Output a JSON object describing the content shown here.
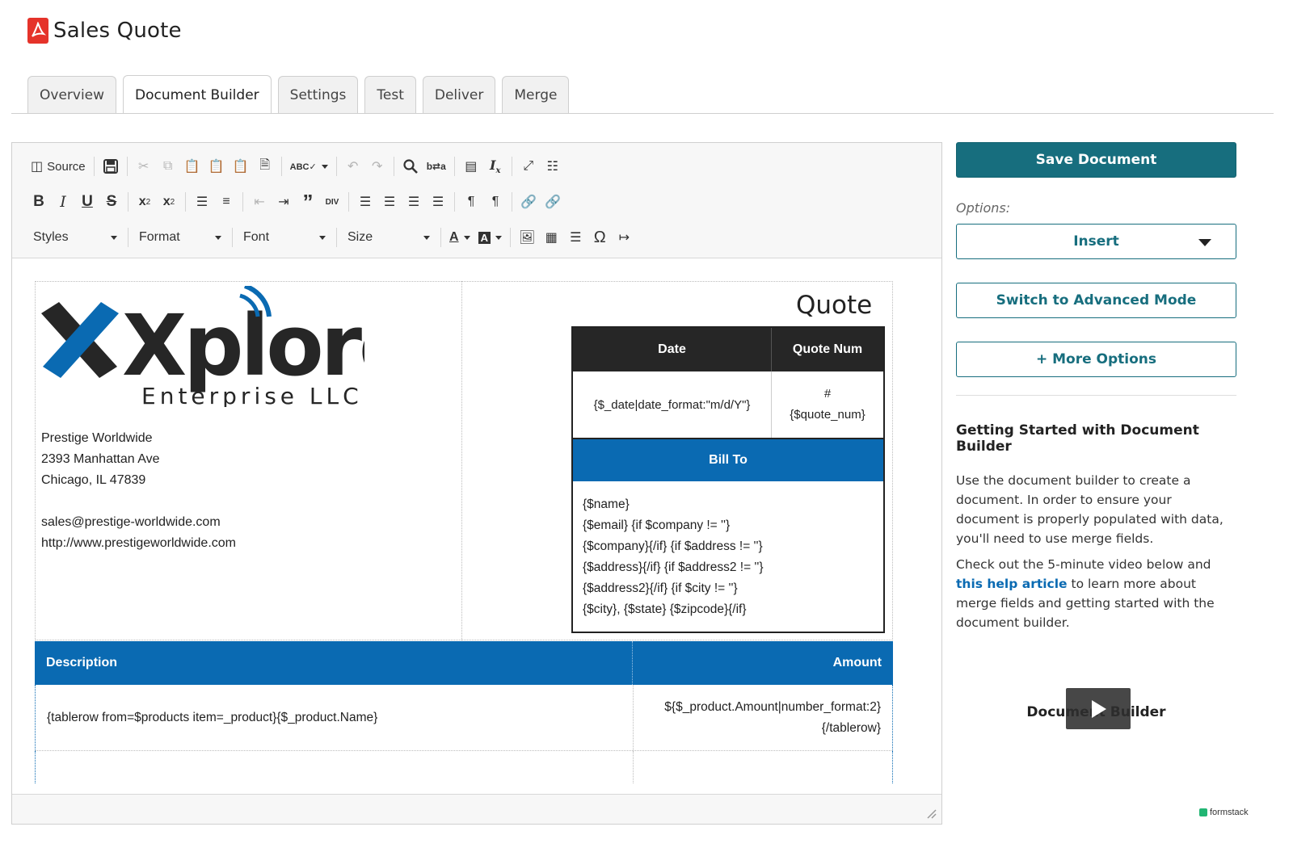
{
  "app": {
    "title": "Sales Quote",
    "icon": "pdf-icon"
  },
  "tabs": [
    {
      "label": "Overview",
      "active": false
    },
    {
      "label": "Document Builder",
      "active": true
    },
    {
      "label": "Settings",
      "active": false
    },
    {
      "label": "Test",
      "active": false
    },
    {
      "label": "Deliver",
      "active": false
    },
    {
      "label": "Merge",
      "active": false
    }
  ],
  "toolbar": {
    "source_label": "Source",
    "styles_label": "Styles",
    "format_label": "Format",
    "font_label": "Font",
    "size_label": "Size"
  },
  "document": {
    "logo": {
      "brand": "Xplore",
      "subtitle": "Enterprise LLC"
    },
    "company": {
      "name": "Prestige Worldwide",
      "street": "2393 Manhattan Ave",
      "city": "Chicago, IL 47839",
      "email": "sales@prestige-worldwide.com",
      "website": "http://www.prestigeworldwide.com"
    },
    "quote_title": "Quote",
    "meta": {
      "date_header": "Date",
      "quote_num_header": "Quote Num",
      "date_value": "{$_date|date_format:\"m/d/Y\"}",
      "quote_num_prefix": "#",
      "quote_num_value": "{$quote_num}"
    },
    "bill_to": {
      "header": "Bill To",
      "lines": [
        "{$name}",
        "{$email} {if $company != ''}",
        "{$company}{/if} {if $address != ''}",
        "{$address}{/if} {if $address2 != ''}",
        "{$address2}{/if} {if $city != ''}",
        "{$city}, {$state} {$zipcode}{/if}"
      ]
    },
    "line_items": {
      "description_header": "Description",
      "amount_header": "Amount",
      "row_description": "{tablerow from=$products item=_product}{$_product.Name}",
      "row_amount_line1": "${$_product.Amount|number_format:2}",
      "row_amount_line2": "{/tablerow}"
    }
  },
  "side_panel": {
    "save_label": "Save Document",
    "options_label": "Options:",
    "insert_label": "Insert",
    "advanced_label": "Switch to Advanced Mode",
    "more_label": "+ More Options",
    "help_title": "Getting Started with Document Builder",
    "help_p1": "Use the document builder to create a document. In order to ensure your document is properly populated with data, you'll need to use merge fields.",
    "help_p2_before": "Check out the 5-minute video below and ",
    "help_p2_link": "this help article",
    "help_p2_after": " to learn more about merge fields and getting started with the document builder.",
    "video_caption": "Document Builder",
    "brand": "formstack"
  },
  "colors": {
    "accent": "#176e7e",
    "doc_blue": "#0a6ab2",
    "pdf_red": "#e5332a",
    "dark_header": "#262626"
  }
}
